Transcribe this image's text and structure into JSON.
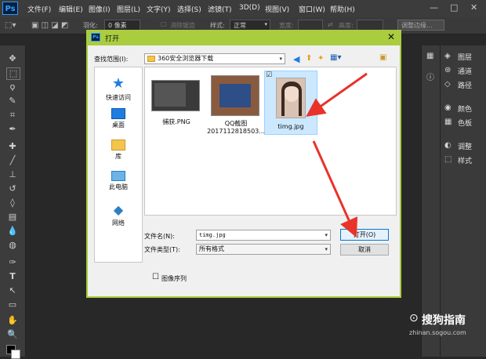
{
  "app": {
    "logo": "Ps",
    "menu": [
      "文件(F)",
      "编辑(E)",
      "图像(I)",
      "图层(L)",
      "文字(Y)",
      "选择(S)",
      "滤镜(T)",
      "3D(D)",
      "视图(V)",
      "窗口(W)",
      "帮助(H)"
    ]
  },
  "options_bar": {
    "feather_label": "羽化:",
    "feather_value": "0 像素",
    "antialias_label": "消除锯齿",
    "style_label": "样式:",
    "style_value": "正常",
    "width_label": "宽度:",
    "height_label": "高度:",
    "refine_edge": "调整边缘..."
  },
  "panels": {
    "items": [
      "图层",
      "通道",
      "路径",
      "颜色",
      "色板",
      "调整",
      "样式"
    ]
  },
  "dialog": {
    "title": "打开",
    "look_in_label": "查找范围(I):",
    "look_in_value": "360安全浏览器下载",
    "places": [
      "快速访问",
      "桌面",
      "库",
      "此电脑",
      "网络"
    ],
    "files": [
      {
        "name": "捕获.PNG",
        "name2": ""
      },
      {
        "name": "QQ截图",
        "name2": "2017112818503..."
      },
      {
        "name": "timg.jpg",
        "name2": "",
        "selected": true
      }
    ],
    "filename_label": "文件名(N):",
    "filename_value": "timg.jpg",
    "filetype_label": "文件类型(T):",
    "filetype_value": "所有格式",
    "open_button": "打开(O)",
    "cancel_button": "取消",
    "image_sequence": "图像序列"
  },
  "watermark": {
    "text": "搜狗指南",
    "url": "zhinan.sogou.com"
  },
  "colors": {
    "dialog_frame": "#aacd40",
    "selection": "#cce8ff",
    "arrow": "#e8332b"
  }
}
